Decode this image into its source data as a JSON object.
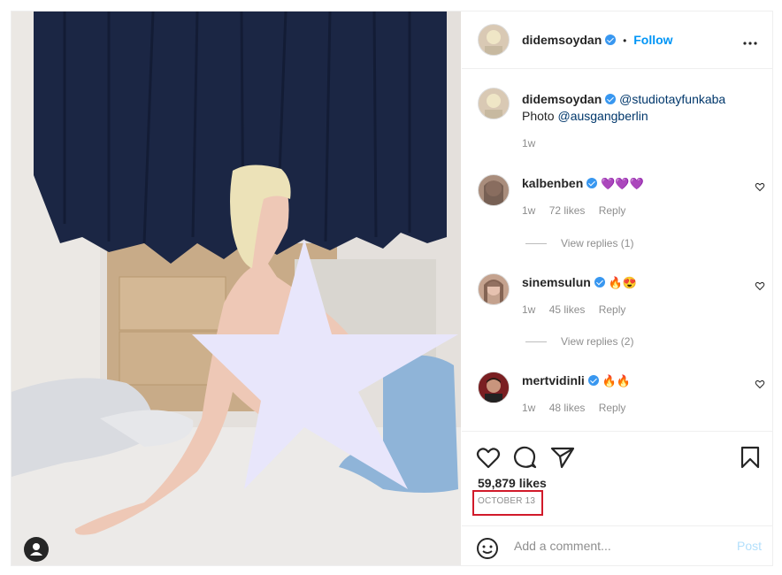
{
  "header": {
    "username": "didemsoydan",
    "separator": "•",
    "follow_label": "Follow",
    "more_icon": "more-horizontal-icon"
  },
  "caption": {
    "username": "didemsoydan",
    "mention": "@studiotayfunkaba",
    "text_prefix": "Photo",
    "text_mention": "@ausgangberlin",
    "time": "1w"
  },
  "comments": [
    {
      "username": "kalbenben",
      "text": "💜💜💜",
      "time": "1w",
      "likes": "72 likes",
      "reply": "Reply",
      "view_replies": "View replies (1)"
    },
    {
      "username": "sinemsulun",
      "text": "🔥😍",
      "time": "1w",
      "likes": "45 likes",
      "reply": "Reply",
      "view_replies": "View replies (2)"
    },
    {
      "username": "mertvidinli",
      "text": "🔥🔥",
      "time": "1w",
      "likes": "48 likes",
      "reply": "Reply"
    }
  ],
  "actions": {
    "likes_count": "59,879 likes",
    "date": "OCTOBER 13"
  },
  "add_comment": {
    "placeholder": "Add a comment...",
    "post_label": "Post"
  },
  "colors": {
    "accent": "#0095f6",
    "verified": "#3897f0",
    "highlight_box": "#d11a2a",
    "star_overlay": "#e8e6fb",
    "curtain": "#1b2644"
  }
}
